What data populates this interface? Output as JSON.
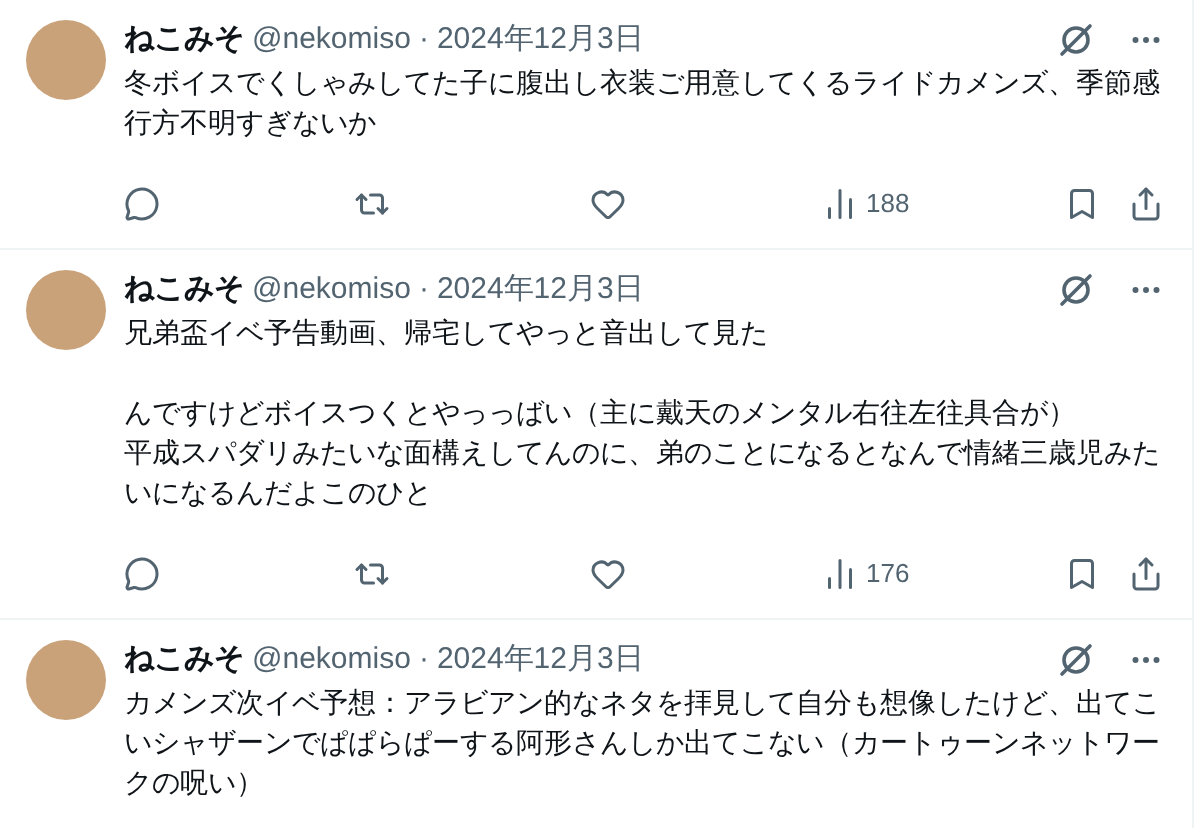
{
  "tweets": [
    {
      "name": "ねこみそ",
      "handle": "@nekomiso",
      "separator": "·",
      "date": "2024年12月3日",
      "blocks": [
        [
          "冬ボイスでくしゃみしてた子に腹出し衣装ご用意してくるライドカメンズ、季節感行方不明すぎないか"
        ]
      ],
      "views": "188"
    },
    {
      "name": "ねこみそ",
      "handle": "@nekomiso",
      "separator": "·",
      "date": "2024年12月3日",
      "blocks": [
        [
          "兄弟盃イベ予告動画、帰宅してやっと音出して見た"
        ],
        [
          "んですけどボイスつくとやっっばい（主に戴天のメンタル右往左往具合が）",
          "平成スパダリみたいな面構えしてんのに、弟のことになるとなんで情緒三歳児みたいになるんだよこのひと"
        ]
      ],
      "views": "176"
    },
    {
      "name": "ねこみそ",
      "handle": "@nekomiso",
      "separator": "·",
      "date": "2024年12月3日",
      "blocks": [
        [
          "カメンズ次イベ予想：アラビアン的なネタを拝見して自分も想像したけど、出てこいシャザーンでぱぱらぱーする阿形さんしか出てこない（カートゥーンネットワークの呪い）"
        ]
      ]
    }
  ]
}
